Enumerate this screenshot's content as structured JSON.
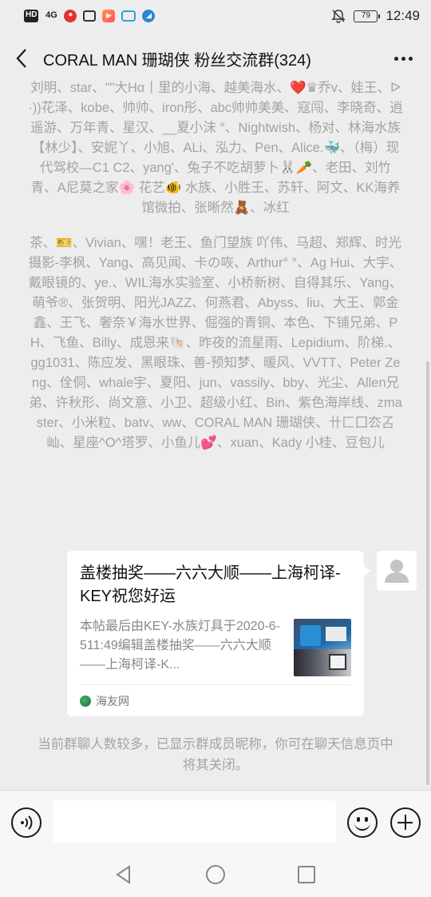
{
  "status_bar": {
    "left_icons": [
      "hd-icon",
      "signal-4g-icon",
      "app-red-icon",
      "app-square-icon",
      "app-play-icon",
      "app-tv-icon",
      "app-blue-icon"
    ],
    "hd": "HD",
    "signal": "4G",
    "battery": "79",
    "time": "12:49"
  },
  "header": {
    "title": "CORAL MAN 珊瑚侠 粉丝交流群(324)"
  },
  "chat": {
    "members_part1": "刘明、star、\"\"大Hα丨里的小海、越美海水、❤️♛乔v、娃王、ᐅ·))花泽、kobe、帅帅、iron彤、abc帅帅美美、寇闯、李晓奇、逍遥游、万年青、星汉、__夏小沫 °、Nightwish、杨对、林海水族【林少】、安妮丫、小旭、ALi、泓力、Pen、Alice.🐳、（梅）现代驾校—C1 C2、yang'、兔子不吃胡萝卜🐰🥕、老田、刘竹青、A尼莫之家🌸 花艺🐠 水族、小胜王、苏轩、阿文、KK海养馆微拍、张晰然🧸、冰红",
    "members_part2": "茶、🎫、Vivian、嘿！老王、鱼门望族 吖伟、马超、郑辉、时光摄影-李枫、Yang、高见闻、卡の咴、Arthur° °、Ag Hui、大宇、戴眼镜的、ye.、WIL海水实验室、小桥新树、自得其乐、Yang、萌爷®、张贺明、阳光JAZZ、何燕君、Abyss、liu、大王、郭金鑫、王飞、奢奈￥海水世界、倔强的青铜、本色、下铺兄弟、PH、飞鱼、Billy、成恩来🐚、昨夜的流星雨、Lepidium、阶梯.、gg1031、陈应发、黑眼珠、善-预知梦、暖风、VVTT、Peter Zeng、佺侗、whale宇、夏阳、jun、vassily、bby、光尘、Allen兄弟、许秋形、尚文意、小卫、超级小红、Bin、紫色海岸线、zmaster、小米粒、batv、ww、CORAL MAN 珊瑚侠、卄匚囗厺叾屾、星座^O^塔罗、小鱼儿💕、xuan、Kady 小桂、豆包儿",
    "card": {
      "title": "盖楼抽奖——六六大顺——上海柯译-KEY祝您好运",
      "description": "本帖最后由KEY-水族灯具于2020-6-511:49编辑盖楼抽奖——六六大顺——上海柯译-K...",
      "source": "海友网"
    },
    "notice": "当前群聊人数较多，已显示群成员昵称，你可在聊天信息页中将其关闭。"
  },
  "input_bar": {
    "placeholder": ""
  },
  "colors": {
    "background": "#ededed",
    "system_text": "#a3a3a3",
    "card_background": "#ffffff"
  }
}
